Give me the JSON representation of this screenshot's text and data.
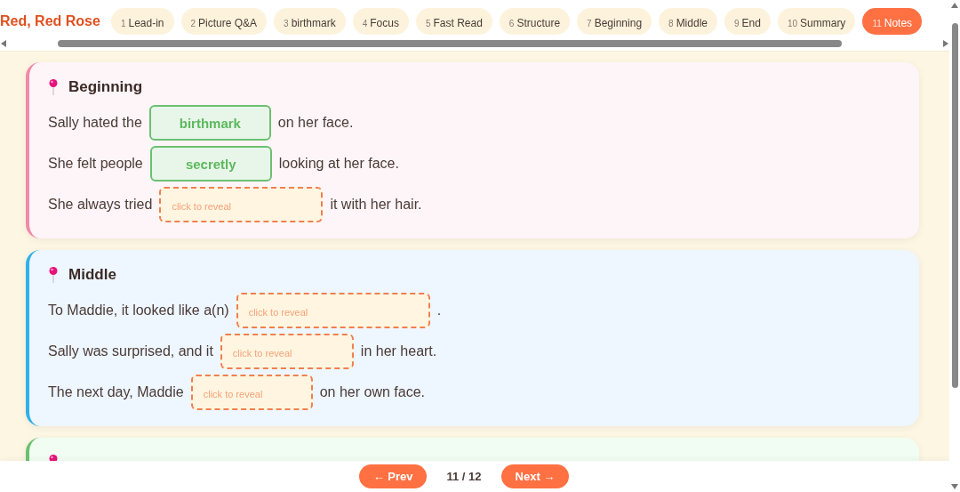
{
  "header": {
    "title": "Red, Red Rose",
    "tabs": [
      {
        "number": "1",
        "label": "Lead-in",
        "selected": false
      },
      {
        "number": "2",
        "label": "Picture Q&A",
        "selected": false
      },
      {
        "number": "3",
        "label": "birthmark",
        "selected": false
      },
      {
        "number": "4",
        "label": "Focus",
        "selected": false
      },
      {
        "number": "5",
        "label": "Fast Read",
        "selected": false
      },
      {
        "number": "6",
        "label": "Structure",
        "selected": false
      },
      {
        "number": "7",
        "label": "Beginning",
        "selected": false
      },
      {
        "number": "8",
        "label": "Middle",
        "selected": false
      },
      {
        "number": "9",
        "label": "End",
        "selected": false
      },
      {
        "number": "10",
        "label": "Summary",
        "selected": false
      },
      {
        "number": "11",
        "label": "Notes",
        "selected": true
      }
    ]
  },
  "sections": [
    {
      "heading": "Beginning",
      "color": "#f08aa8",
      "sentences": [
        {
          "before": "Sally hated the",
          "blank": {
            "revealed": true,
            "text": "birthmark"
          },
          "after": "on her face."
        },
        {
          "before": "She felt people",
          "blank": {
            "revealed": true,
            "text": "secretly"
          },
          "after": "looking at her face."
        },
        {
          "before": "She always tried",
          "blank": {
            "revealed": false,
            "text": "click to reveal"
          },
          "after": "it with her hair."
        }
      ]
    },
    {
      "heading": "Middle",
      "color": "#2fb0e8",
      "sentences": [
        {
          "before": "To Maddie, it looked like a(n)",
          "blank": {
            "revealed": false,
            "text": "click to reveal"
          },
          "after": "."
        },
        {
          "before": "Sally was surprised, and it",
          "blank": {
            "revealed": false,
            "text": "click to reveal"
          },
          "after": "in her heart."
        },
        {
          "before": "The next day, Maddie",
          "blank": {
            "revealed": false,
            "text": "click to reveal"
          },
          "after": "on her own face."
        }
      ]
    },
    {
      "color": "#6cc070"
    }
  ],
  "footer": {
    "prev": "← Prev",
    "page": "11 / 12",
    "next": "Next →"
  }
}
